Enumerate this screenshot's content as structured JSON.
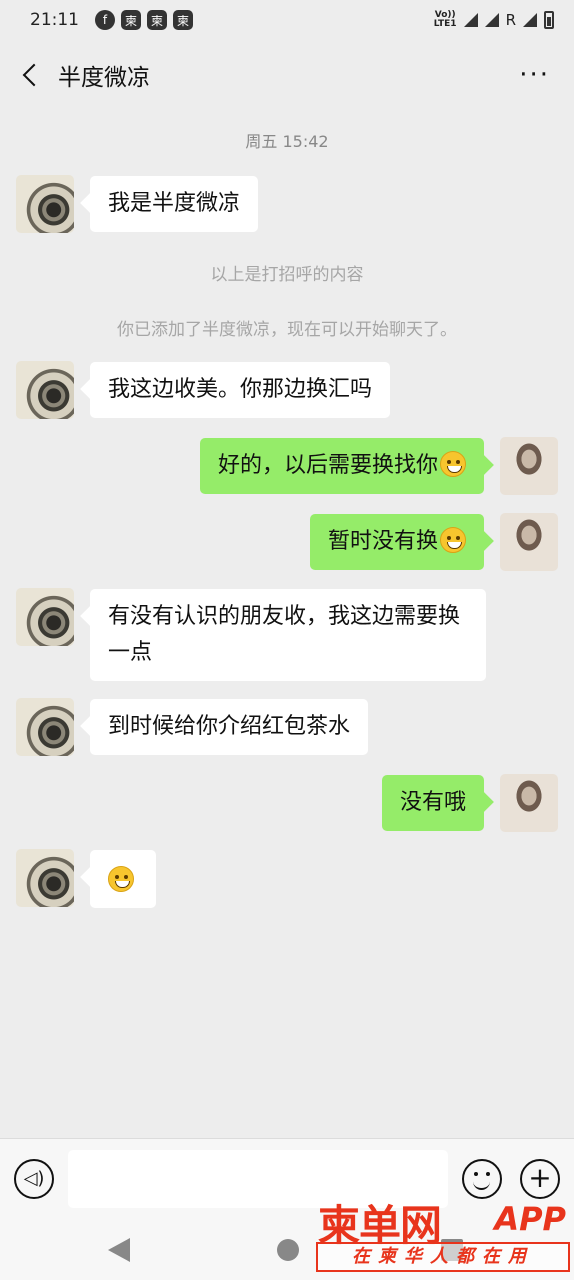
{
  "status_bar": {
    "time": "21:11",
    "notif_icons": [
      "facebook-icon",
      "app-icon",
      "app-icon",
      "app-icon"
    ],
    "volte": "Vo))\nLTE1",
    "roaming": "R"
  },
  "nav": {
    "title": "半度微凉",
    "more": "···"
  },
  "chat": {
    "timestamp": "周五 15:42",
    "messages": [
      {
        "from": "other",
        "text": "我是半度微凉"
      },
      {
        "from": "system",
        "text": "以上是打招呼的内容"
      },
      {
        "from": "system",
        "text": "你已添加了半度微凉，现在可以开始聊天了。"
      },
      {
        "from": "other",
        "text": "我这边收美。你那边换汇吗"
      },
      {
        "from": "me",
        "text": "好的，以后需要换找你",
        "emoji": "smile"
      },
      {
        "from": "me",
        "text": "暂时没有换",
        "emoji": "grin"
      },
      {
        "from": "other",
        "text": "有没有认识的朋友收，我这边需要换一点"
      },
      {
        "from": "other",
        "text": "到时候给你介绍红包茶水"
      },
      {
        "from": "me",
        "text": "没有哦"
      },
      {
        "from": "other",
        "text": "",
        "emoji": "confused"
      }
    ]
  },
  "input_bar": {
    "value": "",
    "placeholder": "",
    "voice_icon": "voice-icon",
    "emoji_icon": "emoji-icon",
    "plus_icon": "plus-icon"
  },
  "watermark": {
    "brand": "柬单网",
    "app": "APP",
    "slogan": "在柬华人都在用"
  }
}
